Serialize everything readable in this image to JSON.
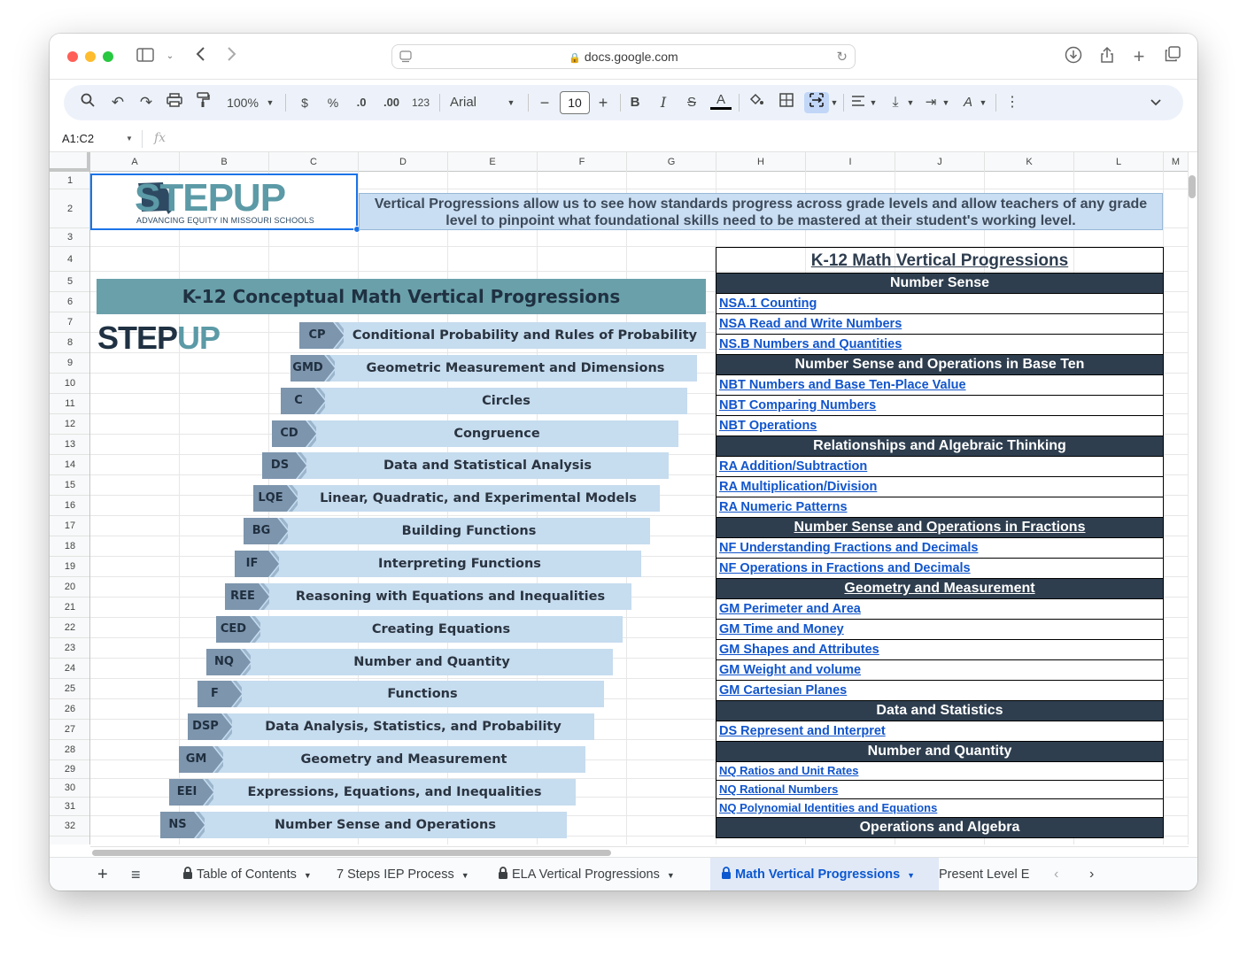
{
  "browser": {
    "url": "docs.google.com"
  },
  "toolbar": {
    "zoom": "100%",
    "currency": "$",
    "percent": "%",
    "dec_less": ".0",
    "dec_more": ".00",
    "number_format": "123",
    "font": "Arial",
    "font_size": "10",
    "minus": "−",
    "plus": "+",
    "bold": "B",
    "italic": "I",
    "strike": "S",
    "text_color": "A"
  },
  "formula_bar": {
    "name_box": "A1:C2",
    "fx": "fx"
  },
  "columns": [
    "A",
    "B",
    "C",
    "D",
    "E",
    "F",
    "G",
    "H",
    "I",
    "J",
    "K",
    "L",
    "M"
  ],
  "rows": [
    "1",
    "2",
    "3",
    "4",
    "5",
    "6",
    "7",
    "8",
    "9",
    "10",
    "11",
    "12",
    "13",
    "14",
    "15",
    "16",
    "17",
    "18",
    "19",
    "20",
    "21",
    "22",
    "23",
    "24",
    "25",
    "26",
    "27",
    "28",
    "29",
    "30",
    "31",
    "32"
  ],
  "logo": {
    "brand": "STEPUP",
    "brand_a": "STEP",
    "brand_b": "UP",
    "tagline": "ADVANCING EQUITY IN MISSOURI SCHOOLS"
  },
  "banner": "Vertical Progressions allow us to see how standards progress across grade levels and allow teachers of any grade level to pinpoint what foundational skills need to be mastered at their student's working level.",
  "progression_image": {
    "title": "K-12 Conceptual Math Vertical Progressions",
    "logo_a": "STEP",
    "logo_b": "UP",
    "items": [
      {
        "code": "CP",
        "label": "Conditional Probability and Rules of Probability"
      },
      {
        "code": "GMD",
        "label": "Geometric Measurement and Dimensions"
      },
      {
        "code": "C",
        "label": "Circles"
      },
      {
        "code": "CD",
        "label": "Congruence"
      },
      {
        "code": "DS",
        "label": "Data and Statistical Analysis"
      },
      {
        "code": "LQE",
        "label": "Linear, Quadratic, and Experimental Models"
      },
      {
        "code": "BG",
        "label": "Building Functions"
      },
      {
        "code": "IF",
        "label": "Interpreting Functions"
      },
      {
        "code": "REE",
        "label": "Reasoning with Equations and Inequalities"
      },
      {
        "code": "CED",
        "label": "Creating Equations"
      },
      {
        "code": "NQ",
        "label": "Number and Quantity"
      },
      {
        "code": "F",
        "label": "Functions"
      },
      {
        "code": "DSP",
        "label": "Data Analysis, Statistics, and Probability"
      },
      {
        "code": "GM",
        "label": "Geometry and Measurement"
      },
      {
        "code": "EEI",
        "label": "Expressions, Equations, and Inequalities"
      },
      {
        "code": "NS",
        "label": "Number Sense and Operations"
      }
    ]
  },
  "math_table": {
    "title": "K-12 Math Vertical Progressions",
    "rows": [
      {
        "type": "head",
        "text": "Number Sense"
      },
      {
        "type": "link",
        "text": "NSA.1 Counting"
      },
      {
        "type": "link",
        "text": "NSA Read and Write Numbers"
      },
      {
        "type": "link",
        "text": "NS.B Numbers and Quantities"
      },
      {
        "type": "head",
        "text": "Number Sense and Operations in Base Ten"
      },
      {
        "type": "link",
        "text": "NBT Numbers and Base Ten-Place Value"
      },
      {
        "type": "link",
        "text": "NBT Comparing Numbers"
      },
      {
        "type": "link",
        "text": "NBT Operations"
      },
      {
        "type": "head",
        "text": "Relationships and Algebraic Thinking"
      },
      {
        "type": "link",
        "text": "RA Addition/Subtraction"
      },
      {
        "type": "link",
        "text": "RA Multiplication/Division"
      },
      {
        "type": "link",
        "text": "RA Numeric Patterns"
      },
      {
        "type": "head-ul",
        "text": "Number Sense and Operations in Fractions"
      },
      {
        "type": "link",
        "text": "NF Understanding Fractions and Decimals"
      },
      {
        "type": "link",
        "text": "NF Operations in Fractions and Decimals"
      },
      {
        "type": "head-ul",
        "text": "Geometry and Measurement"
      },
      {
        "type": "link",
        "text": "GM Perimeter and Area"
      },
      {
        "type": "link",
        "text": "GM Time and Money"
      },
      {
        "type": "link",
        "text": "GM Shapes and Attributes"
      },
      {
        "type": "link",
        "text": "GM Weight and volume"
      },
      {
        "type": "link",
        "text": "GM Cartesian Planes"
      },
      {
        "type": "head",
        "text": "Data and Statistics"
      },
      {
        "type": "link",
        "text": "DS Represent and Interpret"
      },
      {
        "type": "head",
        "text": "Number and Quantity"
      },
      {
        "type": "link-small",
        "text": "NQ Ratios and Unit Rates"
      },
      {
        "type": "link-small",
        "text": "NQ Rational Numbers"
      },
      {
        "type": "link-small",
        "text": "NQ Polynomial Identities and Equations"
      },
      {
        "type": "head",
        "text": "Operations and Algebra"
      }
    ]
  },
  "sheet_tabs": [
    {
      "label": "Table of Contents",
      "locked": true,
      "active": false
    },
    {
      "label": "7 Steps IEP Process",
      "locked": false,
      "active": false
    },
    {
      "label": "ELA Vertical Progressions",
      "locked": true,
      "active": false
    },
    {
      "label": "Math Vertical Progressions",
      "locked": true,
      "active": true
    },
    {
      "label": "Present Level E",
      "locked": false,
      "active": false
    }
  ],
  "colors": {
    "accent": "#0b57d0",
    "header_dark": "#2e3e4f",
    "banner": "#c9def2",
    "bar": "#c6dcef",
    "teal": "#6aa0aa"
  }
}
